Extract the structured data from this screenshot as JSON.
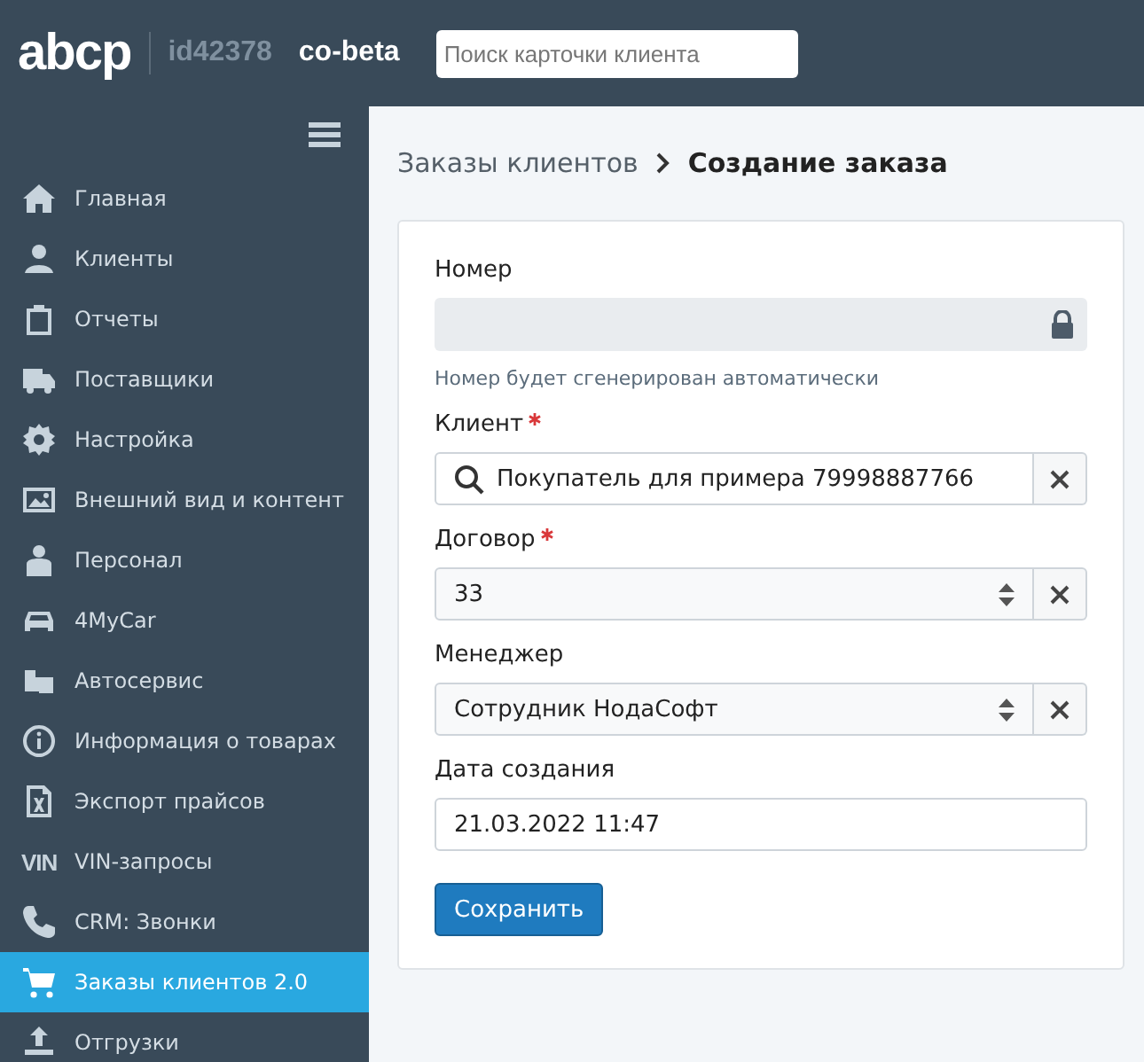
{
  "header": {
    "logo": "abcp",
    "account_id": "id42378",
    "site": "co-beta",
    "search": {
      "placeholder": "Поиск карточки клиента"
    }
  },
  "sidebar": {
    "items": [
      {
        "label": "Главная",
        "selected": false
      },
      {
        "label": "Клиенты",
        "selected": false
      },
      {
        "label": "Отчеты",
        "selected": false
      },
      {
        "label": "Поставщики",
        "selected": false
      },
      {
        "label": "Настройка",
        "selected": false
      },
      {
        "label": "Внешний вид и контент",
        "selected": false
      },
      {
        "label": "Персонал",
        "selected": false
      },
      {
        "label": "4MyCar",
        "selected": false
      },
      {
        "label": "Автосервис",
        "selected": false
      },
      {
        "label": "Информация о товарах",
        "selected": false
      },
      {
        "label": "Экспорт прайсов",
        "selected": false
      },
      {
        "label": "VIN-запросы",
        "selected": false,
        "icon_text": "VIN"
      },
      {
        "label": "CRM: Звонки",
        "selected": false
      },
      {
        "label": "Заказы клиентов 2.0",
        "selected": true
      },
      {
        "label": "Отгрузки",
        "selected": false
      }
    ]
  },
  "breadcrumb": {
    "parent": "Заказы клиентов",
    "current": "Создание заказа"
  },
  "form": {
    "fields": [
      {
        "kind": "locked",
        "label": "Номер",
        "required": false,
        "hint": "Номер будет сгенерирован автоматически"
      },
      {
        "kind": "search",
        "label": "Клиент",
        "required": true,
        "value": "Покупатель для примера  79998887766"
      },
      {
        "kind": "select",
        "label": "Договор",
        "required": true,
        "value": "33"
      },
      {
        "kind": "select",
        "label": "Менеджер",
        "required": false,
        "value": "Сотрудник НодаСофт"
      },
      {
        "kind": "text",
        "label": "Дата создания",
        "required": false,
        "value": "21.03.2022 11:47"
      }
    ],
    "submit": "Сохранить"
  }
}
